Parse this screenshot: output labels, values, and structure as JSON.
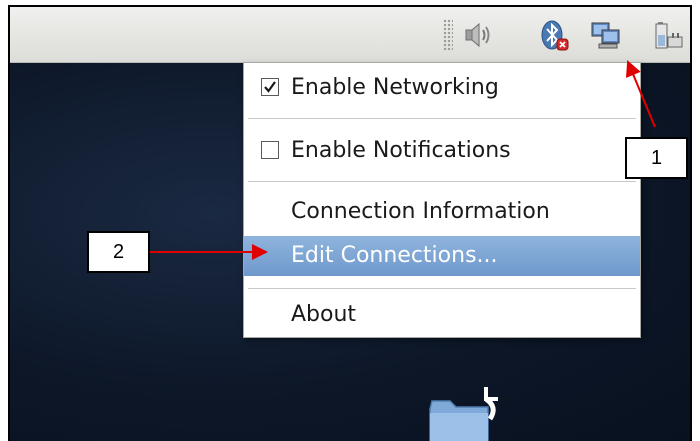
{
  "menu": {
    "items": [
      {
        "label": "Enable Networking",
        "checked": true
      },
      {
        "label": "Enable Notifications",
        "checked": false
      },
      {
        "label": "Connection Information"
      },
      {
        "label": "Edit Connections..."
      },
      {
        "label": "About"
      }
    ]
  },
  "tray": {
    "icons": [
      "speaker-volume-icon",
      "bluetooth-disabled-icon",
      "network-manager-icon",
      "battery-icon"
    ]
  },
  "callouts": {
    "one": "1",
    "two": "2"
  },
  "colors": {
    "highlight": "#7aa3d4",
    "annotation_arrow": "#e00000",
    "desktop": "#0e1a2e"
  }
}
